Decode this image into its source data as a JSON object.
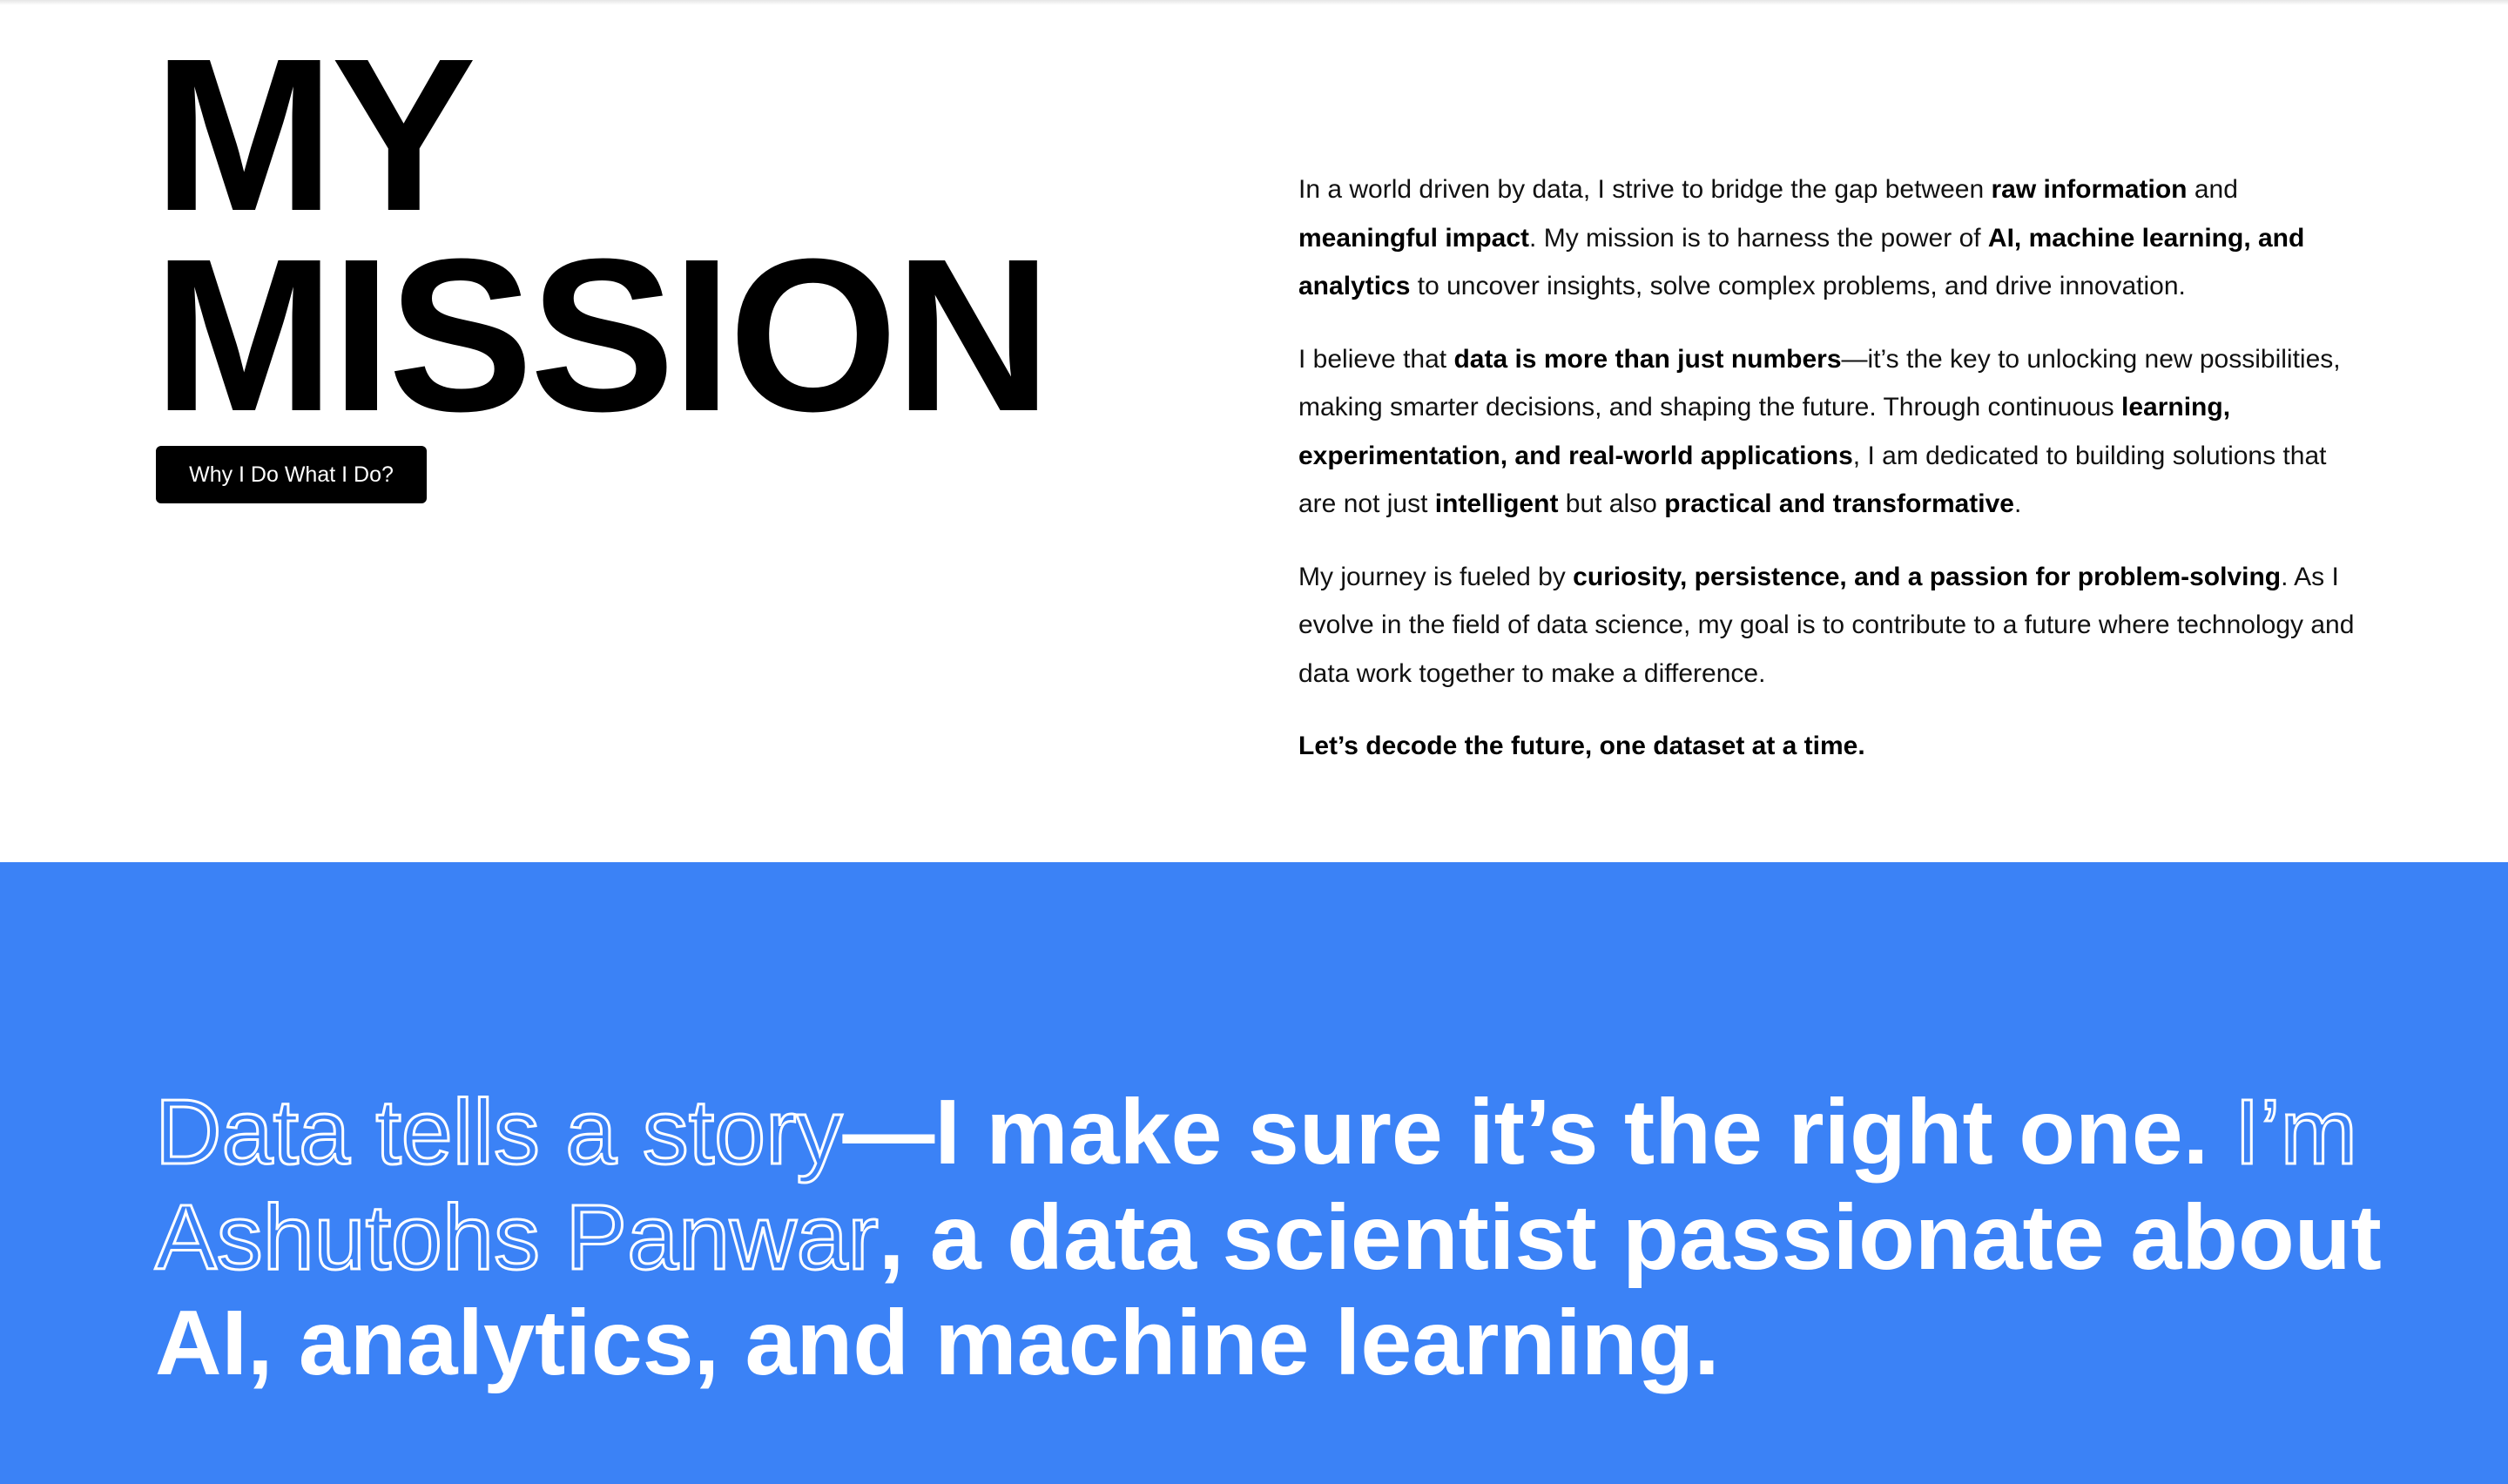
{
  "mission": {
    "title_line1": "MY",
    "title_line2": "MISSION",
    "button_label": "Why I Do What I Do?",
    "paragraphs": [
      [
        {
          "text": "In a world driven by data, I strive to bridge the gap between ",
          "bold": false
        },
        {
          "text": "raw information",
          "bold": true
        },
        {
          "text": " and ",
          "bold": false
        },
        {
          "text": "meaningful impact",
          "bold": true
        },
        {
          "text": ". My mission is to harness the power of ",
          "bold": false
        },
        {
          "text": "AI, machine learning, and analytics",
          "bold": true
        },
        {
          "text": " to uncover insights, solve complex problems, and drive innovation.",
          "bold": false
        }
      ],
      [
        {
          "text": "I believe that ",
          "bold": false
        },
        {
          "text": "data is more than just numbers",
          "bold": true
        },
        {
          "text": "—it’s the key to unlocking new possibilities, making smarter decisions, and shaping the future. Through continuous ",
          "bold": false
        },
        {
          "text": "learning, experimentation, and real-world applications",
          "bold": true
        },
        {
          "text": ", I am dedicated to building solutions that are not just ",
          "bold": false
        },
        {
          "text": "intelligent",
          "bold": true
        },
        {
          "text": " but also ",
          "bold": false
        },
        {
          "text": "practical and transformative",
          "bold": true
        },
        {
          "text": ".",
          "bold": false
        }
      ],
      [
        {
          "text": "My journey is fueled by ",
          "bold": false
        },
        {
          "text": "curiosity, persistence, and a passion for problem-solving",
          "bold": true
        },
        {
          "text": ". As I evolve in the field of data science, my goal is to contribute to a future where technology and data work together to make a difference.",
          "bold": false
        }
      ],
      [
        {
          "text": "Let’s decode the future, one dataset at a time.",
          "bold": true
        }
      ]
    ]
  },
  "tagline": {
    "segments": [
      {
        "text": "Data tells a story",
        "style": "outline"
      },
      {
        "text": "—I make sure it’s the right one. ",
        "style": "solid"
      },
      {
        "text": "I’m Ashutohs Panwar",
        "style": "outline"
      },
      {
        "text": ", a data scientist passionate about AI, analytics, and machine learning.",
        "style": "solid"
      }
    ]
  },
  "colors": {
    "band_background": "#3b82f6",
    "button_background": "#000000",
    "text_primary": "#000000",
    "tagline_text": "#ffffff"
  }
}
